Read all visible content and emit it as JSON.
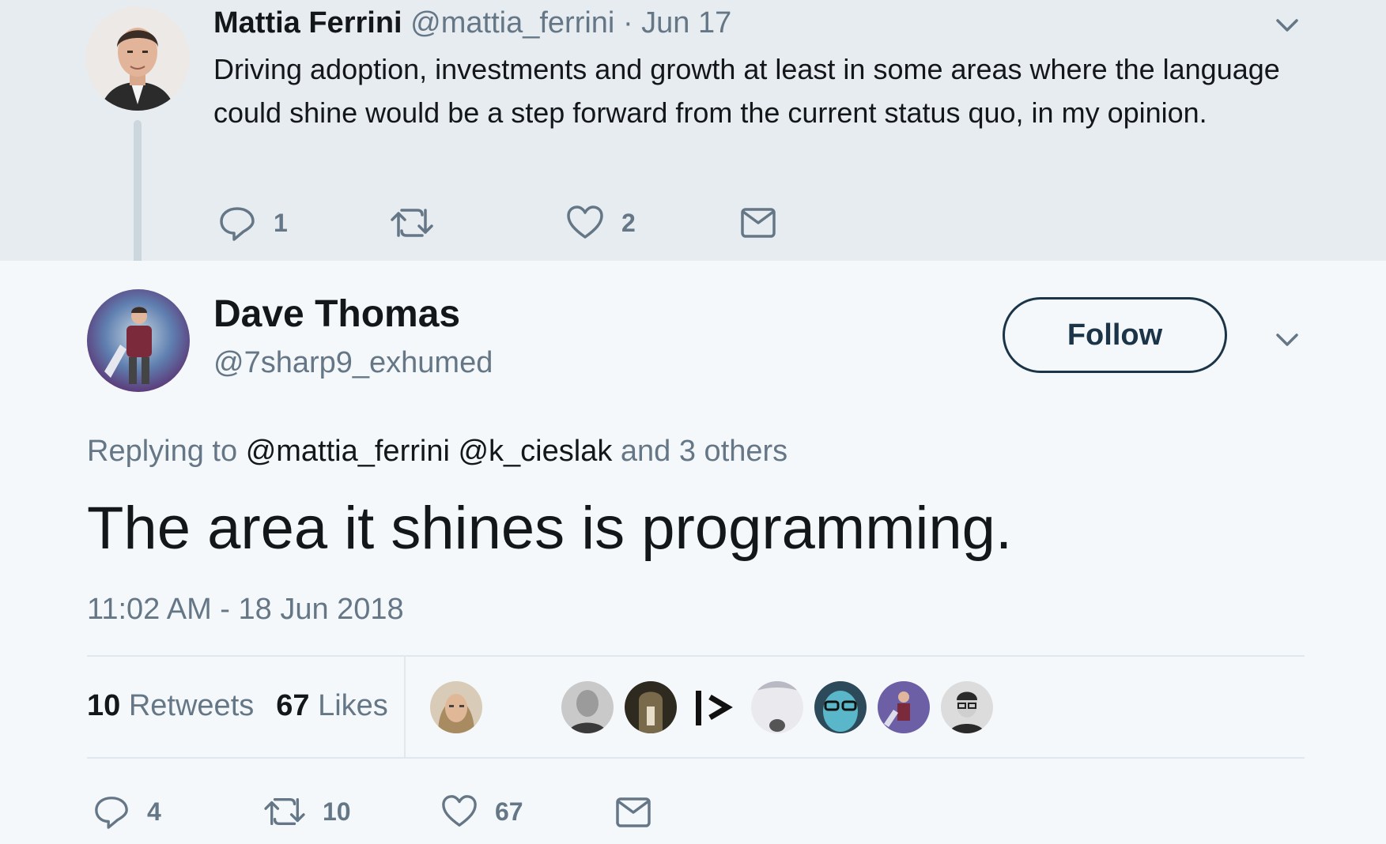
{
  "parent_tweet": {
    "name": "Mattia Ferrini",
    "handle": "@mattia_ferrini",
    "separator": "·",
    "date": "Jun 17",
    "text": "Driving adoption, investments and growth at least in some areas where the language could shine would be a step forward from the current status quo, in my opinion.",
    "actions": {
      "reply_count": "1",
      "retweet_count": "",
      "like_count": "2"
    }
  },
  "main_tweet": {
    "name": "Dave Thomas",
    "handle": "@7sharp9_exhumed",
    "follow_label": "Follow",
    "replying_prefix": "Replying to",
    "mention_1": "@mattia_ferrini",
    "mention_2": "@k_cieslak",
    "replying_suffix": "and 3 others",
    "text": "The area it shines is programming.",
    "timestamp": "11:02 AM - 18 Jun 2018",
    "retweets_count": "10",
    "retweets_label": "Retweets",
    "likes_count": "67",
    "likes_label": "Likes",
    "actions": {
      "reply_count": "4",
      "retweet_count": "10",
      "like_count": "67"
    }
  },
  "liker_avatar_count": 9,
  "colors": {
    "parent_bg": "#e6ecf0",
    "main_bg": "#f5f8fa",
    "text": "#14171a",
    "secondary": "#657786",
    "follow_border": "#1b3447"
  }
}
